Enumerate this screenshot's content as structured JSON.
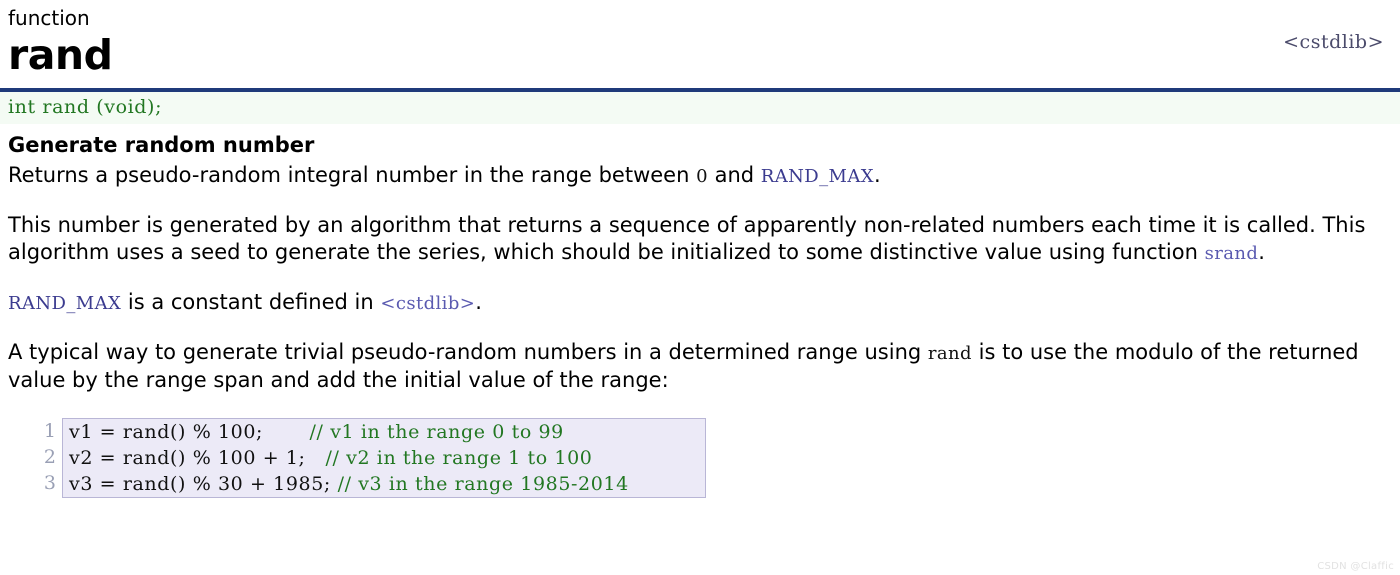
{
  "header": {
    "kind": "function",
    "name": "rand",
    "include": "<cstdlib>"
  },
  "signature": {
    "text": "int rand (void);"
  },
  "description": {
    "title": "Generate random number",
    "paragraphs": [
      {
        "parts": [
          {
            "type": "text",
            "value": "Returns a pseudo-random integral number in the range between "
          },
          {
            "type": "code-lit",
            "value": "0"
          },
          {
            "type": "text",
            "value": " and "
          },
          {
            "type": "code-link",
            "value": "RAND_MAX"
          },
          {
            "type": "text",
            "value": "."
          }
        ]
      },
      {
        "parts": [
          {
            "type": "text",
            "value": "This number is generated by an algorithm that returns a sequence of apparently non-related numbers each time it is called. This algorithm uses a seed to generate the series, which should be initialized to some distinctive value using function "
          },
          {
            "type": "code-link2",
            "value": "srand"
          },
          {
            "type": "text",
            "value": "."
          }
        ]
      },
      {
        "parts": [
          {
            "type": "code-link",
            "value": "RAND_MAX"
          },
          {
            "type": "text",
            "value": " is a constant defined in "
          },
          {
            "type": "code-link2",
            "value": "<cstdlib>"
          },
          {
            "type": "text",
            "value": "."
          }
        ]
      },
      {
        "parts": [
          {
            "type": "text",
            "value": "A typical way to generate trivial pseudo-random numbers in a determined range using "
          },
          {
            "type": "code-lit",
            "value": "rand"
          },
          {
            "type": "text",
            "value": " is to use the modulo of the returned value by the range span and add the initial value of the range:"
          }
        ]
      }
    ]
  },
  "example": {
    "lines": [
      {
        "number": "1",
        "statement": "v1 = rand() % 100;       ",
        "comment": "// v1 in the range 0 to 99"
      },
      {
        "number": "2",
        "statement": "v2 = rand() % 100 + 1;   ",
        "comment": "// v2 in the range 1 to 100"
      },
      {
        "number": "3",
        "statement": "v3 = rand() % 30 + 1985; ",
        "comment": "// v3 in the range 1985-2014"
      }
    ]
  },
  "watermark": {
    "text": "CSDN @Claffic"
  },
  "colors": {
    "rule": "#1f3a7a",
    "signature_text": "#227722",
    "signature_bg": "#f4fbf4",
    "link": "#3b3b8f",
    "link_secondary": "#5a5ab0",
    "code_bg": "#eceaf7",
    "code_border": "#b9b6d6",
    "comment": "#227722",
    "gutter": "#9aa0b5"
  }
}
